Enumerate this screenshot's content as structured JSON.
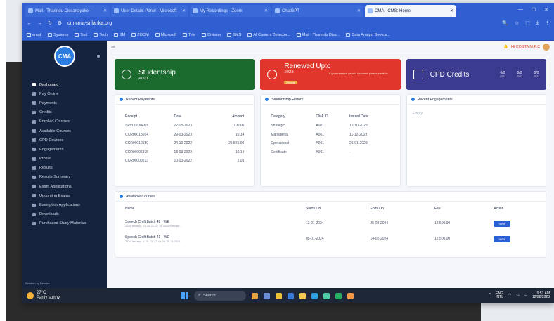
{
  "browser": {
    "tabs": [
      {
        "label": "Mail - Tharindu Dissanayake - ",
        "active": false
      },
      {
        "label": "User Details Panel - Microsoft",
        "active": false
      },
      {
        "label": "My Recordings - Zoom",
        "active": false
      },
      {
        "label": "ChatGPT",
        "active": false
      },
      {
        "label": "CMA - CMS: Home",
        "active": true
      }
    ],
    "url": "cm.cma-srilanka.org",
    "bookmarks": [
      "email",
      "Systems",
      "Tool",
      "Tech",
      "SM",
      "ZOOM",
      "Microsoft",
      "Tele",
      "Division",
      "SMS",
      "AI Content Detector...",
      "Mail - Tharindu Diss...",
      "Data Analyst Bootca..."
    ]
  },
  "sidebar": {
    "logo": "CMA",
    "items": [
      "Dashboard",
      "Pay Online",
      "Payments",
      "Credits",
      "Enrolled Courses",
      "Available Courses",
      "CPD Courses",
      "Engagements",
      "Profile",
      "Results",
      "Results Summary",
      "Exam Applications",
      "Upcoming Exams",
      "Exemption Applications",
      "Downloads",
      "Purchased Study Materials"
    ],
    "footer": "Solution by Senaka"
  },
  "topbar": {
    "user": "Hi COSTA M.P.C"
  },
  "cards": {
    "studentship": {
      "title": "Studentship",
      "sub": "A001"
    },
    "renewed": {
      "title": "Renewed Upto",
      "sub": "2023",
      "badge": "Renew",
      "note": "If your renewal year is incorrect please email to"
    },
    "cpd": {
      "title": "CPD Credits",
      "values": [
        {
          "v": "0/0",
          "y": "2023"
        },
        {
          "v": "0/0",
          "y": "2022"
        },
        {
          "v": "0/0",
          "y": "2021"
        }
      ]
    }
  },
  "payments": {
    "title": "Recent Payments",
    "headers": [
      "Receipt",
      "Date",
      "Amount"
    ],
    "rows": [
      [
        "SPV00000463",
        "22-05-2023",
        "100.00"
      ],
      [
        "CCR00018914",
        "29-03-2023",
        "10.14"
      ],
      [
        "CCR00012150",
        "24-10-2022",
        "25,525.00"
      ],
      [
        "CCR00006375",
        "18-03-2022",
        "10.14"
      ],
      [
        "CCR00008233",
        "10-03-2022",
        "2.03"
      ]
    ]
  },
  "history": {
    "title": "Studentship History",
    "headers": [
      "Category",
      "CMA ID",
      "Issued Date"
    ],
    "rows": [
      [
        "Strategic",
        "A001",
        "12-10-2023"
      ],
      [
        "Managerial",
        "A001",
        "11-12-2023"
      ],
      [
        "Operational",
        "A001",
        "25-01-2023"
      ],
      [
        "Certificate",
        "A001",
        "-"
      ]
    ]
  },
  "engagements": {
    "title": "Recent Engagements",
    "empty": "Empty"
  },
  "courses": {
    "title": "Available Courses",
    "headers": [
      "Name",
      "Starts On",
      "Ends On",
      "Fee",
      "Action"
    ],
    "rows": [
      {
        "name": "Speech Craft Batch 42 - WE",
        "sub": "2024 January - 13, 20, 21, 27, 28 2024 February -",
        "start": "13-01-2024",
        "end": "25-02-2024",
        "fee": "12,500.00",
        "action": "View"
      },
      {
        "name": "Speech Craft Batch 41 - WD",
        "sub": "2024 January - 5, 10, 12, 17, 19, 24, 26, 31 2024.",
        "start": "05-01-2024",
        "end": "14-02-2024",
        "fee": "12,500.00",
        "action": "View"
      }
    ]
  },
  "taskbar": {
    "temp": "27°C",
    "weather": "Partly sunny",
    "search": "Search",
    "lang1": "ENG",
    "lang2": "INTL",
    "time": "9:51 AM",
    "date": "12/28/2023"
  }
}
